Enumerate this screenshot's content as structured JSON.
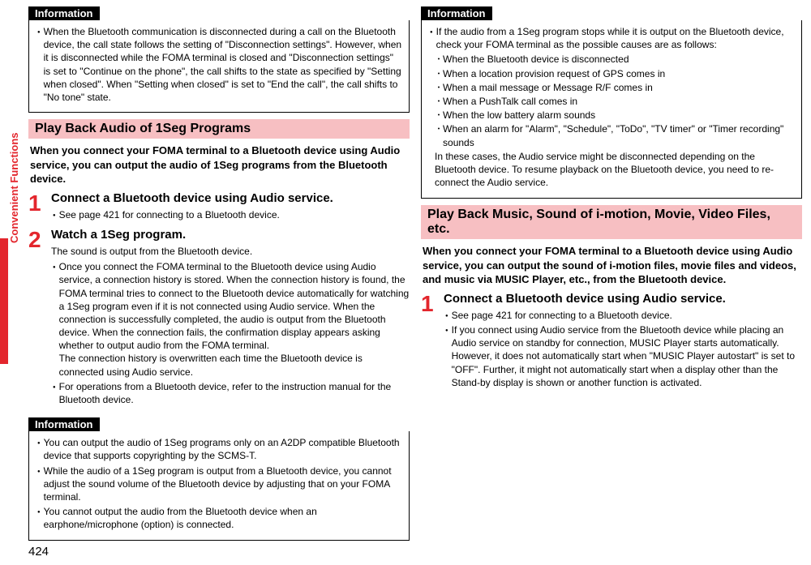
{
  "left": {
    "info1": {
      "header": "Information",
      "item1": "When the Bluetooth communication is disconnected during a call on the Bluetooth device, the call state follows the setting of \"Disconnection settings\". However, when it is disconnected while the FOMA terminal is closed and \"Disconnection settings\" is set to \"Continue on the phone\", the call shifts to the state as specified by \"Setting when closed\". When \"Setting when closed\" is set to \"End the call\", the call shifts to \"No tone\" state."
    },
    "section1": {
      "title": "Play Back Audio of 1Seg Programs",
      "intro": "When you connect your FOMA terminal to a Bluetooth device using Audio service, you can output the audio of 1Seg programs from the Bluetooth device.",
      "step1": {
        "num": "1",
        "title": "Connect a Bluetooth device using Audio service.",
        "b1": "See page 421 for connecting to a Bluetooth device."
      },
      "step2": {
        "num": "2",
        "title": "Watch a 1Seg program.",
        "text": "The sound is output from the Bluetooth device.",
        "b1a": "Once you connect the FOMA terminal to the Bluetooth device using Audio service, a connection history is stored. When the connection history is found, the FOMA terminal tries to connect to the Bluetooth device automatically for watching a 1Seg program even if it is not connected using Audio service. When the connection is successfully completed, the audio is output from the Bluetooth device. When the connection fails, the confirmation display appears asking whether to output audio from the FOMA terminal.",
        "b1b": "The connection history is overwritten each time the Bluetooth device is connected using Audio service.",
        "b2": "For operations from a Bluetooth device, refer to the instruction manual for the Bluetooth device."
      }
    },
    "info2": {
      "header": "Information",
      "i1": "You can output the audio of 1Seg programs only on an A2DP compatible Bluetooth device that supports copyrighting by the SCMS-T.",
      "i2": "While the audio of a 1Seg program is output from a Bluetooth device, you cannot adjust the sound volume of the Bluetooth device by adjusting that on your FOMA terminal.",
      "i3": "You cannot output the audio from the Bluetooth device when an earphone/microphone (option) is connected."
    }
  },
  "right": {
    "info1": {
      "header": "Information",
      "intro": "If the audio from a 1Seg program stops while it is output on the Bluetooth device, check your FOMA terminal as the possible causes are as follows:",
      "d1": "When the Bluetooth device is disconnected",
      "d2": "When a location provision request of GPS comes in",
      "d3": "When a mail message or Message R/F comes in",
      "d4": "When a PushTalk call comes in",
      "d5": "When the low battery alarm sounds",
      "d6": "When an alarm for \"Alarm\", \"Schedule\", \"ToDo\", \"TV timer\" or \"Timer recording\" sounds",
      "out": "In these cases, the Audio service might be disconnected depending on the Bluetooth device. To resume playback on the Bluetooth device, you need to re-connect the Audio service."
    },
    "section2": {
      "title": "Play Back Music, Sound of i-motion, Movie, Video Files, etc.",
      "intro": "When you connect your FOMA terminal to a Bluetooth device using Audio service, you can output the sound of i-motion files, movie files and videos, and music via MUSIC Player, etc., from the Bluetooth device.",
      "step1": {
        "num": "1",
        "title": "Connect a Bluetooth device using Audio service.",
        "b1": "See page 421 for connecting to a Bluetooth device.",
        "b2": "If you connect using Audio service from the Bluetooth device while placing an Audio service on standby for connection, MUSIC Player starts automatically. However, it does not automatically start when \"MUSIC Player autostart\" is set to \"OFF\". Further, it might not automatically start when a display other than the Stand-by display is shown or another function is activated."
      }
    }
  },
  "side": "Convenient Functions",
  "pagenum": "424"
}
